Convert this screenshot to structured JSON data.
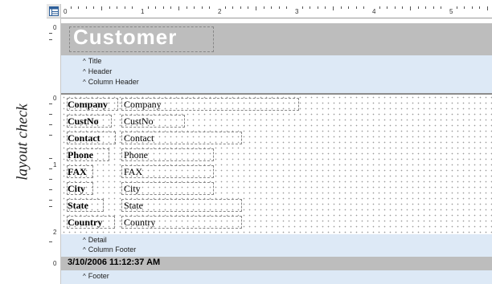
{
  "side_label": "layout check",
  "ruler": {
    "marks": [
      "0",
      "1",
      "2",
      "3",
      "4",
      "5"
    ],
    "vertical_marks": [
      "0",
      "0",
      "1",
      "2",
      "0"
    ]
  },
  "title_band": {
    "title": "Customer"
  },
  "section_labels": {
    "title": "Title",
    "header": "Header",
    "column_header": "Column Header",
    "detail": "Detail",
    "column_footer": "Column Footer",
    "footer": "Footer"
  },
  "detail": {
    "fields": [
      {
        "label": "Company",
        "value": "Company"
      },
      {
        "label": "CustNo",
        "value": "CustNo"
      },
      {
        "label": "Contact",
        "value": "Contact"
      },
      {
        "label": "Phone",
        "value": "Phone"
      },
      {
        "label": "FAX",
        "value": "FAX"
      },
      {
        "label": "City",
        "value": "City"
      },
      {
        "label": "State",
        "value": "State"
      },
      {
        "label": "Country",
        "value": "Country"
      }
    ]
  },
  "footer_band": {
    "timestamp": "3/10/2006 11:12:37 AM"
  },
  "colors": {
    "band_gray": "#bdbdbd",
    "band_blue": "#dde9f6",
    "title_text": "#ffffff"
  },
  "icons": {
    "corner": "report-layout-icon"
  }
}
